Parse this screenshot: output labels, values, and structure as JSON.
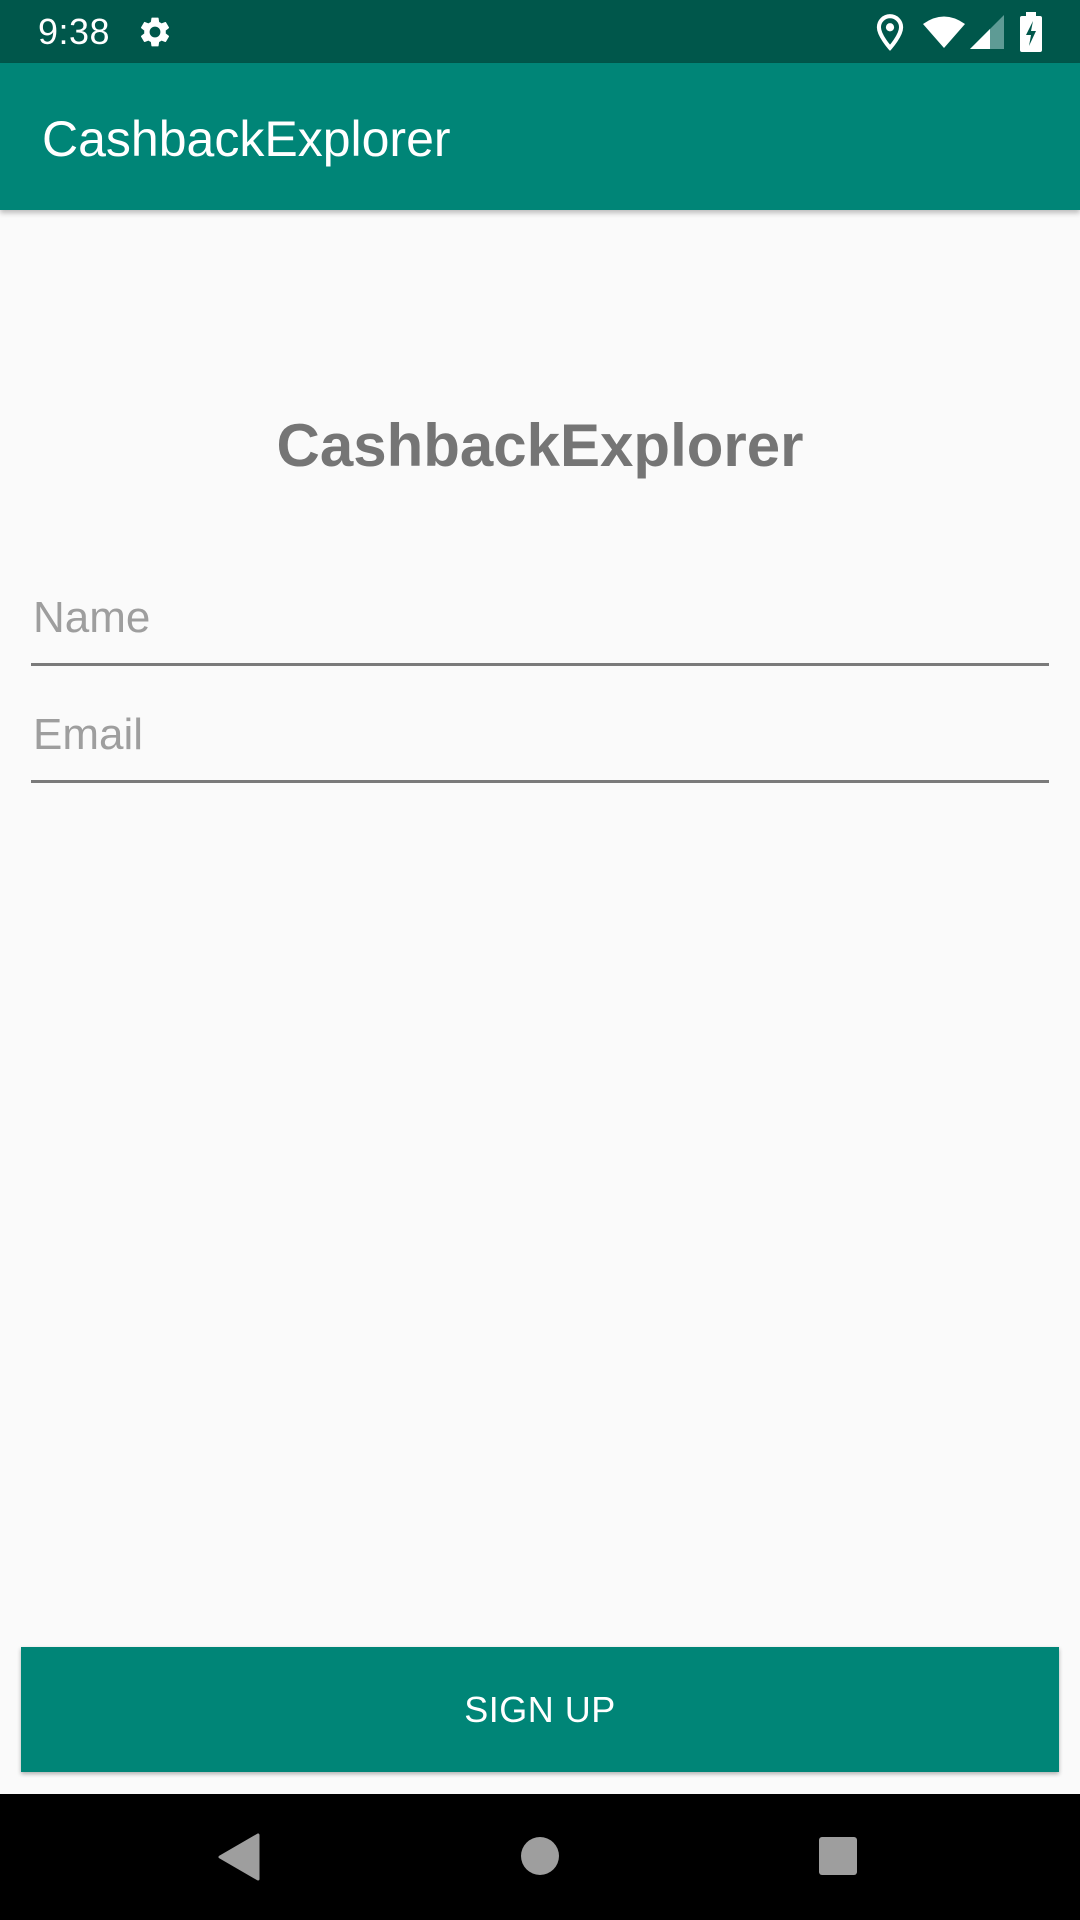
{
  "status_bar": {
    "time": "9:38",
    "icons": [
      "settings-icon",
      "location-icon",
      "wifi-icon",
      "signal-icon",
      "battery-charging-icon"
    ]
  },
  "app_bar": {
    "title": "CashbackExplorer"
  },
  "main": {
    "heading": "CashbackExplorer",
    "name_field": {
      "value": "",
      "placeholder": "Name"
    },
    "email_field": {
      "value": "",
      "placeholder": "Email"
    },
    "signup_label": "SIGN UP"
  },
  "nav_bar": {
    "icons": [
      "back-icon",
      "home-icon",
      "recents-icon"
    ]
  },
  "colors": {
    "primary": "#008577",
    "primary_dark": "#00574B",
    "background": "#FAFAFA",
    "heading_text": "#757575",
    "hint_text": "#9E9E9E"
  }
}
